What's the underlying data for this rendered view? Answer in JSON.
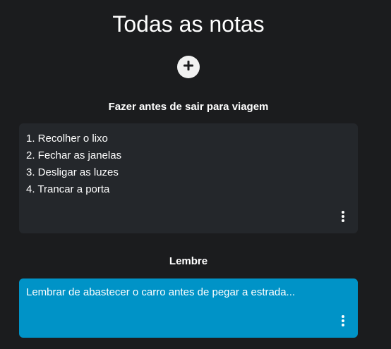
{
  "header": {
    "title": "Todas as notas",
    "add_icon": "plus-icon"
  },
  "notes": [
    {
      "title": "Fazer antes de sair para viagem",
      "lines": [
        "1. Recolher o lixo",
        "2. Fechar as janelas",
        "3. Desligar as luzes",
        "4. Trancar a porta"
      ],
      "color": "#24272b",
      "menu_icon": "kebab-menu-icon"
    },
    {
      "title": "Lembre",
      "body": "Lembrar de abastecer o carro antes de pegar a estrada...",
      "color": "#0093c7",
      "menu_icon": "kebab-menu-icon"
    }
  ],
  "theme": {
    "background": "#1b1c1e",
    "text": "#ffffff"
  }
}
